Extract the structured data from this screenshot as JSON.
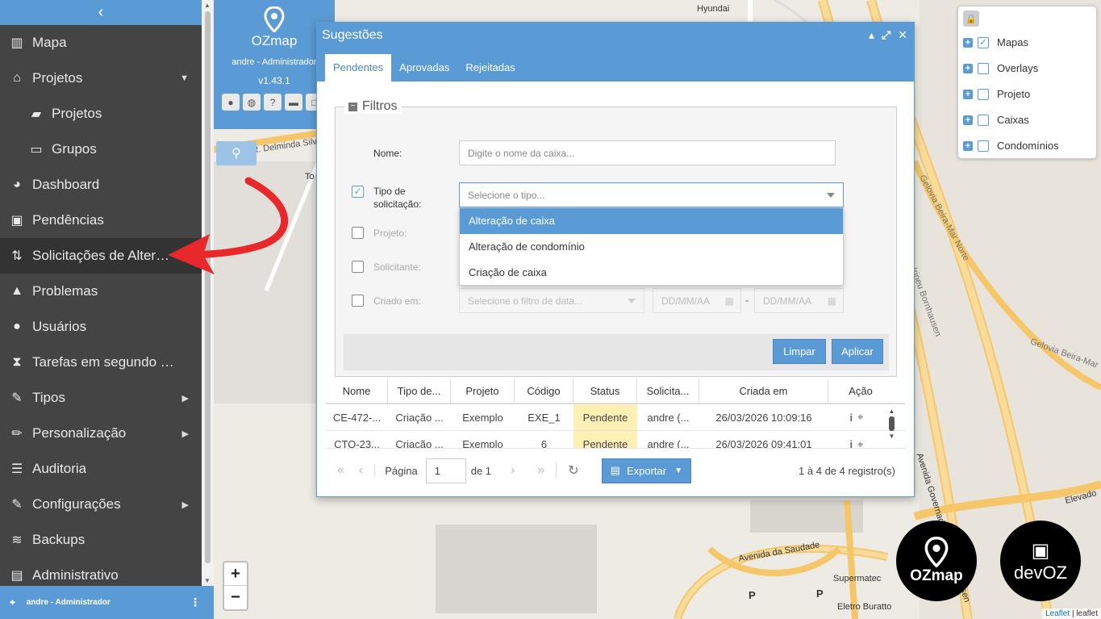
{
  "sidebar": {
    "items": [
      {
        "label": "Mapa",
        "icon": "map-icon"
      },
      {
        "label": "Projetos",
        "icon": "home-icon"
      },
      {
        "label": "Projetos",
        "icon": "book-icon"
      },
      {
        "label": "Grupos",
        "icon": "folder-open-icon"
      },
      {
        "label": "Dashboard",
        "icon": "pie-chart-icon"
      },
      {
        "label": "Pendências",
        "icon": "briefcase-icon"
      },
      {
        "label": "Solicitações de Alteraç...",
        "icon": "git-pull-request-icon"
      },
      {
        "label": "Problemas",
        "icon": "warning-icon"
      },
      {
        "label": "Usuários",
        "icon": "user-icon"
      },
      {
        "label": "Tarefas em segundo pl...",
        "icon": "hourglass-icon"
      },
      {
        "label": "Tipos",
        "icon": "wrench-icon"
      },
      {
        "label": "Personalização",
        "icon": "pencil-icon"
      },
      {
        "label": "Auditoria",
        "icon": "list-icon"
      },
      {
        "label": "Configurações",
        "icon": "wrench-icon"
      },
      {
        "label": "Backups",
        "icon": "database-icon"
      },
      {
        "label": "Administrativo",
        "icon": "file-icon"
      }
    ],
    "footer_user": "andre - Administrador"
  },
  "header": {
    "logo_text": "OZmap",
    "user": "andre - Administrador",
    "version": "v1.43.1"
  },
  "map": {
    "labels": [
      "Hyundai",
      "R. Delminda Silv",
      "To",
      "Avenida da Saudade",
      "Supermatec",
      "Eletro Buratto",
      "Avenida Governador Irineu Bornhausen",
      "Elevado",
      "Gelovia Beira-Mar Norte",
      "Gelovia Beira-Mar",
      "Irineu Bornhausen",
      "P",
      "P"
    ],
    "attribution_link": "Leaflet",
    "attribution_text": "| leaflet",
    "watermark1": "OZmap",
    "watermark2": "devOZ"
  },
  "layers": [
    "Mapas",
    "Overlays",
    "Projeto",
    "Caixas",
    "Condomínios"
  ],
  "modal": {
    "title": "Sugestões",
    "tabs": [
      "Pendentes",
      "Aprovadas",
      "Rejeitadas"
    ],
    "filters_legend": "Filtros",
    "name_label": "Nome:",
    "name_placeholder": "Digite o nome da caixa...",
    "type_label": "Tipo de solicitação:",
    "type_placeholder": "Selecione o tipo...",
    "type_options": [
      "Alteração de caixa",
      "Alteração de condomínio",
      "Criação de caixa"
    ],
    "project_label": "Projeto:",
    "requester_label": "Solicitante:",
    "created_label": "Criado em:",
    "date_filter_placeholder": "Selecione o filtro de data...",
    "date_placeholder": "DD/MM/AA",
    "date_sep": "-",
    "clear_button": "Limpar",
    "apply_button": "Aplicar",
    "columns": [
      "Nome",
      "Tipo de...",
      "Projeto",
      "Código",
      "Status",
      "Solicita...",
      "Criada em",
      "Ação"
    ],
    "rows": [
      [
        "CE-472-...",
        "Criação ...",
        "Exemplo",
        "EXE_1",
        "Pendente",
        "andre (...",
        "26/03/2026 10:09:16"
      ],
      [
        "CTO-23...",
        "Criação ...",
        "Exemplo",
        "6",
        "Pendente",
        "andre (...",
        "26/03/2026 09:41:01"
      ]
    ],
    "page_label": "Página",
    "page_value": "1",
    "page_of": "de 1",
    "export_button": "Exportar",
    "records": "1 à 4 de 4 registro(s)"
  },
  "colors": {
    "accent": "#5b9bd5",
    "sidebar": "#444444",
    "status_pending": "#fdf0b4",
    "arrow": "#e8282b"
  }
}
